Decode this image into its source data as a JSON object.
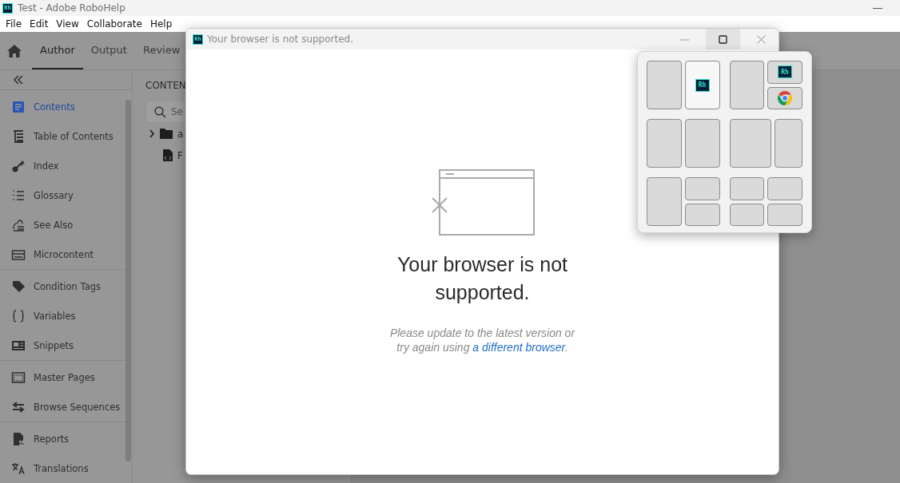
{
  "window": {
    "logo": "Rh",
    "title": "Test - Adobe RoboHelp"
  },
  "menu": [
    "File",
    "Edit",
    "View",
    "Collaborate",
    "Help"
  ],
  "tabs": [
    {
      "label": "Author",
      "selected": true
    },
    {
      "label": "Output",
      "selected": false
    },
    {
      "label": "Review",
      "selected": false
    }
  ],
  "sidebar": {
    "sections": [
      [
        {
          "label": "Contents",
          "selected": true
        },
        {
          "label": "Table of Contents",
          "selected": false
        },
        {
          "label": "Index",
          "selected": false
        },
        {
          "label": "Glossary",
          "selected": false
        },
        {
          "label": "See Also",
          "selected": false
        },
        {
          "label": "Microcontent",
          "selected": false
        }
      ],
      [
        {
          "label": "Condition Tags",
          "selected": false
        },
        {
          "label": "Variables",
          "selected": false
        },
        {
          "label": "Snippets",
          "selected": false
        }
      ],
      [
        {
          "label": "Master Pages",
          "selected": false
        },
        {
          "label": "Browse Sequences",
          "selected": false
        }
      ],
      [
        {
          "label": "Reports",
          "selected": false
        },
        {
          "label": "Translations",
          "selected": false
        }
      ]
    ]
  },
  "contents_panel": {
    "heading": "CONTEN",
    "search": {
      "placeholder": "Se"
    },
    "tree": [
      {
        "label": "a",
        "kind": "folder",
        "expanded": false
      },
      {
        "label": "F",
        "kind": "file"
      }
    ]
  },
  "dialog": {
    "logo": "Rh",
    "title": "Your browser is not supported.",
    "heading": "Your browser is not supported.",
    "message": "Please update to the latest version or try again using",
    "link": "a different browser",
    "message_end": "."
  },
  "snap_layouts": [
    {
      "kind": "halves",
      "zones": [
        {
          "kind": "blank",
          "selected": false
        },
        {
          "kind": "rh",
          "logo": "Rh",
          "selected": true
        }
      ]
    },
    {
      "kind": "split-right",
      "zones": [
        {
          "kind": "blank",
          "selected": false
        },
        {
          "kind": "rh",
          "logo": "Rh",
          "selected": false
        },
        {
          "kind": "chrome",
          "selected": false
        }
      ]
    },
    {
      "kind": "halves",
      "zones": [
        {
          "kind": "blank",
          "selected": false
        },
        {
          "kind": "blank",
          "selected": false
        }
      ]
    },
    {
      "kind": "wide-narrow",
      "zones": [
        {
          "kind": "blank",
          "selected": false
        },
        {
          "kind": "blank",
          "selected": false
        }
      ]
    },
    {
      "kind": "split-right",
      "zones": [
        {
          "kind": "blank",
          "selected": false
        },
        {
          "kind": "blank",
          "selected": false
        },
        {
          "kind": "blank",
          "selected": false
        }
      ]
    },
    {
      "kind": "quads",
      "zones": [
        {
          "kind": "blank",
          "selected": false
        },
        {
          "kind": "blank",
          "selected": false
        },
        {
          "kind": "blank",
          "selected": false
        },
        {
          "kind": "blank",
          "selected": false
        }
      ]
    }
  ]
}
